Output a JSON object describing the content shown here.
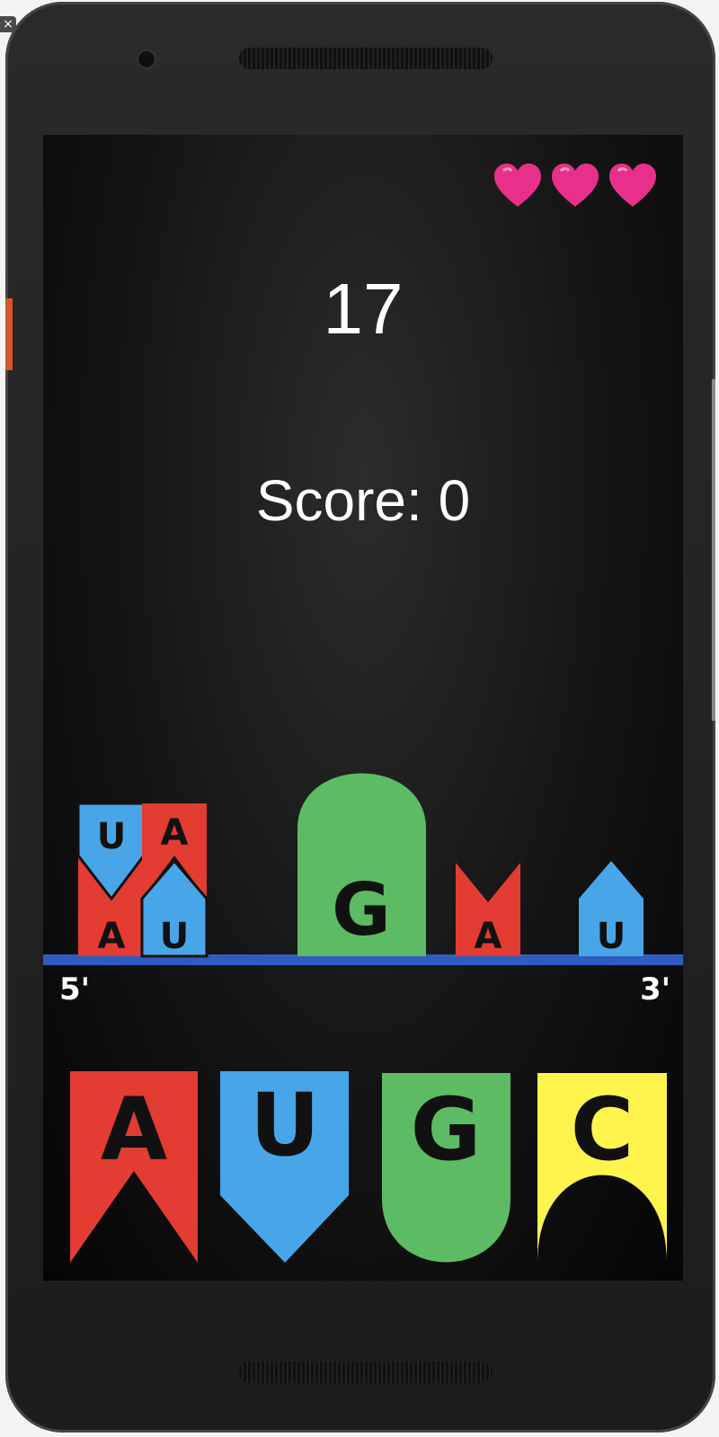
{
  "app": {
    "close_glyph": "×"
  },
  "hud": {
    "timer": "17",
    "score_text": "Score: 0",
    "lives": 3,
    "heart_color": "#e8308a"
  },
  "strand": {
    "five_prime_label": "5'",
    "three_prime_label": "3'",
    "line_color": "#2f5cc0",
    "stacked_pairs": [
      {
        "top": "U",
        "bottom": "A"
      },
      {
        "top": "A",
        "bottom": "U"
      }
    ],
    "placed": [
      "G",
      "A",
      "U"
    ]
  },
  "palette": {
    "A": "#e23c33",
    "U": "#48a6e8",
    "G": "#5dbb63",
    "C": "#fff44e"
  },
  "buttons": [
    {
      "letter": "A",
      "name": "base-button-a"
    },
    {
      "letter": "U",
      "name": "base-button-u"
    },
    {
      "letter": "G",
      "name": "base-button-g"
    },
    {
      "letter": "C",
      "name": "base-button-c"
    }
  ]
}
